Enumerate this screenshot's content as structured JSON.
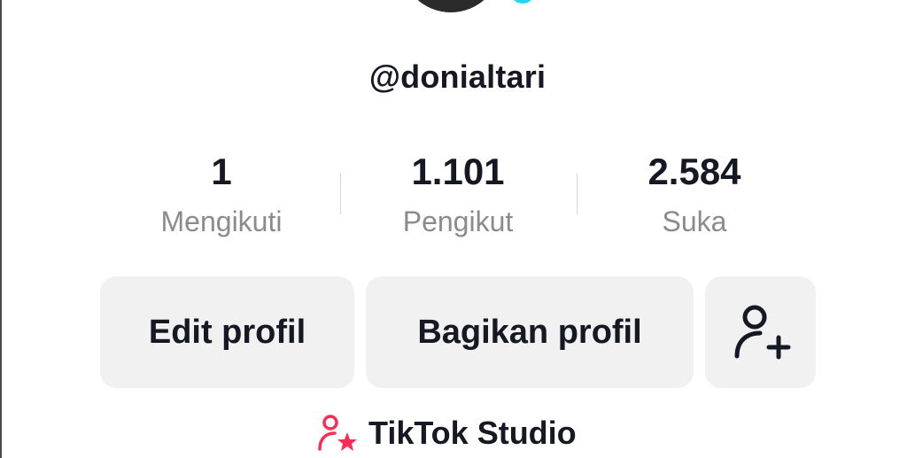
{
  "profile": {
    "username": "@donialtari"
  },
  "stats": [
    {
      "value": "1",
      "label": "Mengikuti"
    },
    {
      "value": "1.101",
      "label": "Pengikut"
    },
    {
      "value": "2.584",
      "label": "Suka"
    }
  ],
  "actions": {
    "edit_label": "Edit profil",
    "share_label": "Bagikan profil",
    "add_friend_icon": "person-plus-icon"
  },
  "studio": {
    "label": "TikTok Studio",
    "icon": "person-star-icon",
    "icon_color": "#fe2c55"
  },
  "colors": {
    "badge": "#20d5ec",
    "button_bg": "#f1f1f2",
    "label_gray": "#8a8b91"
  }
}
